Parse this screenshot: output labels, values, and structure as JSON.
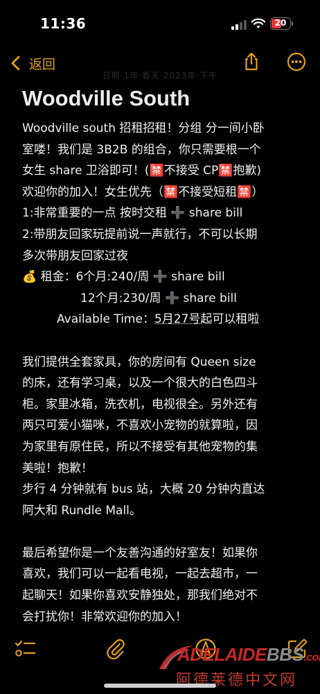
{
  "status_bar": {
    "time": "11:36",
    "battery": "20"
  },
  "nav": {
    "back_label": "返回"
  },
  "faded_subtitle": "日期·1年·春天·2023年·下午",
  "note": {
    "title": "Woodville South",
    "lines": [
      "Woodville south 招租招租！分组 分一间小卧",
      "室喽！我们是 3B2B 的组合，你只需要根一个",
      "女生 share 卫浴即可！(🈲不接受 CP🈲抱歉)",
      "欢迎你的加入！女生优先（🈲不接受短租🈲）",
      "1:非常重要的一点 按时交租 ➕ share bill",
      "2:带朋友回家玩提前说一声就行，不可以长期",
      "多次带朋友回家过夜",
      "💰 租金：6个月:240/周 ➕ share bill",
      "12个月:230/周 ➕ share bill",
      "Available Time：",
      "5月27号",
      "起可以租啦",
      "我们提供全套家具，你的房间有 Queen size",
      "的床，还有学习桌，以及一个很大的白色四斗",
      "柜。家里冰箱，洗衣机，电视很全。另外还有",
      "两只可爱小猫咪，不喜欢小宠物的就算啦，因",
      "为家里有原住民，所以不接受有其他宠物的集",
      "美啦！抱歉！",
      "步行 4 分钟就有 bus 站，大概 20 分钟内直达",
      "阿大和 Rundle Mall。",
      "最后希望你是一个友善沟通的好室友！如果你",
      "喜欢，我们可以一起看电视，一起去超市，一",
      "起聊天！如果你喜欢安静独处，那我们绝对不",
      "会打扰你！非常欢迎你的加入！"
    ]
  },
  "watermark": {
    "brand_a": "ADELAIDE",
    "brand_b": "BBS",
    "brand_c": ".com",
    "chinese": "阿德莱德中文网"
  },
  "colors": {
    "accent": "#e3a21a",
    "background": "#000000",
    "text": "#f0f0f0",
    "battery_low": "#e53935"
  },
  "icons": {
    "back": "chevron-left-icon",
    "share": "share-icon",
    "more": "ellipsis-circle-icon",
    "checklist": "checklist-icon",
    "attachment": "paperclip-icon",
    "markup": "pen-circle-icon",
    "compose": "compose-icon"
  }
}
